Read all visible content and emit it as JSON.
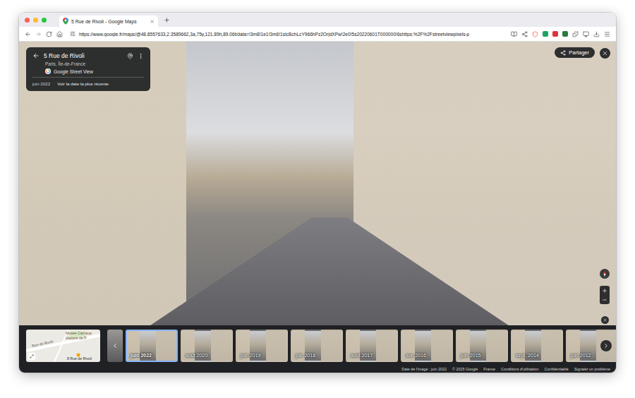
{
  "tab": {
    "title": "5 Rue de Rivoli - Google Maps",
    "selected": true
  },
  "address_bar": {
    "url": "https://www.google.fr/maps/@48.8557633,2.3589662,3a,75y,121.89h,89.06t/data=!3m8!1e1!3m6!1sIcBchLcY966hPz2OrjdXPw!2e0!5s20220601T000000!6shttps:%2F%2Fstreetviewpixels-p"
  },
  "street_view": {
    "info": {
      "title": "5 Rue de Rivoli",
      "subtitle": "Paris, Île-de-France",
      "source": "Google Street View",
      "date": "juin 2022",
      "latest_link": "Voir la date la plus récente"
    },
    "share_button": "Partager",
    "map": {
      "labels": [
        "Musée Carnava",
        "Histoire de P",
        "Rue de Rivoli",
        "8 Rue de Rivoli"
      ]
    },
    "timeline": [
      {
        "label": "juin 2022",
        "selected": true
      },
      {
        "label": "août 2020",
        "selected": false
      },
      {
        "label": "juin 2019",
        "selected": false
      },
      {
        "label": "juil. 2018",
        "selected": false
      },
      {
        "label": "août 2017",
        "selected": false
      },
      {
        "label": "avr. 2016",
        "selected": false
      },
      {
        "label": "juin 2015",
        "selected": false
      },
      {
        "label": "sept. 2014",
        "selected": false
      },
      {
        "label": "juin 2012",
        "selected": false
      }
    ],
    "footer": [
      "Date de l'image : juin 2022",
      "© 2025 Google",
      "France",
      "Conditions d'utilisation",
      "Confidentialité",
      "Signaler un problème"
    ]
  }
}
